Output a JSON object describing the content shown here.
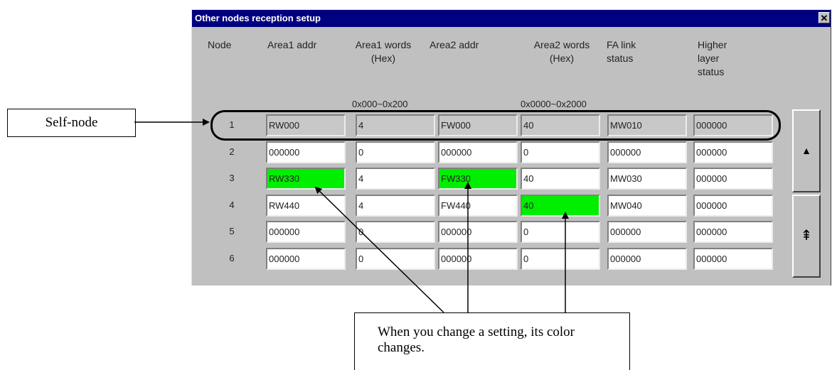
{
  "window": {
    "title": "Other nodes reception setup",
    "close_glyph": "✕",
    "close_icon": "close-icon"
  },
  "headers": {
    "node": "Node",
    "area1_addr": "Area1 addr",
    "area1_words": "Area1 words\n(Hex)",
    "area1_range": "0x000~0x200",
    "area2_addr": "Area2 addr",
    "area2_words": "Area2 words\n(Hex)",
    "area2_range": "0x0000~0x2000",
    "fa_link_status": "FA link\nstatus",
    "higher_layer_status": "Higher\nlayer\nstatus"
  },
  "rows": [
    {
      "node": "1",
      "area1_addr": "RW000",
      "area1_words": "4",
      "area2_addr": "FW000",
      "area2_words": "40",
      "fa_link_status": "MW010",
      "higher_layer_status": "000000",
      "self": true
    },
    {
      "node": "2",
      "area1_addr": "000000",
      "area1_words": "0",
      "area2_addr": "000000",
      "area2_words": "0",
      "fa_link_status": "000000",
      "higher_layer_status": "000000"
    },
    {
      "node": "3",
      "area1_addr": "RW330",
      "area1_words": "4",
      "area2_addr": "FW330",
      "area2_words": "40",
      "fa_link_status": "MW030",
      "higher_layer_status": "000000"
    },
    {
      "node": "4",
      "area1_addr": "RW440",
      "area1_words": "4",
      "area2_addr": "FW440",
      "area2_words": "40",
      "fa_link_status": "MW040",
      "higher_layer_status": "000000"
    },
    {
      "node": "5",
      "area1_addr": "000000",
      "area1_words": "0",
      "area2_addr": "000000",
      "area2_words": "0",
      "fa_link_status": "000000",
      "higher_layer_status": "000000"
    },
    {
      "node": "6",
      "area1_addr": "000000",
      "area1_words": "0",
      "area2_addr": "000000",
      "area2_words": "0",
      "fa_link_status": "000000",
      "higher_layer_status": "000000"
    }
  ],
  "changed_cells": [
    "3.area1_addr",
    "3.area2_addr",
    "4.area2_words"
  ],
  "colors": {
    "changed": "#00ee00",
    "title_bar": "#000080",
    "self_row": "#c8c8c8"
  },
  "scroll": {
    "up_glyph": "▲",
    "up_icon": "arrow-up-icon",
    "page_up_glyph": "⇞",
    "page_up_icon": "page-up-icon"
  },
  "callouts": {
    "self_node": "Self-node",
    "change_note": "When you change a setting, its color changes."
  }
}
